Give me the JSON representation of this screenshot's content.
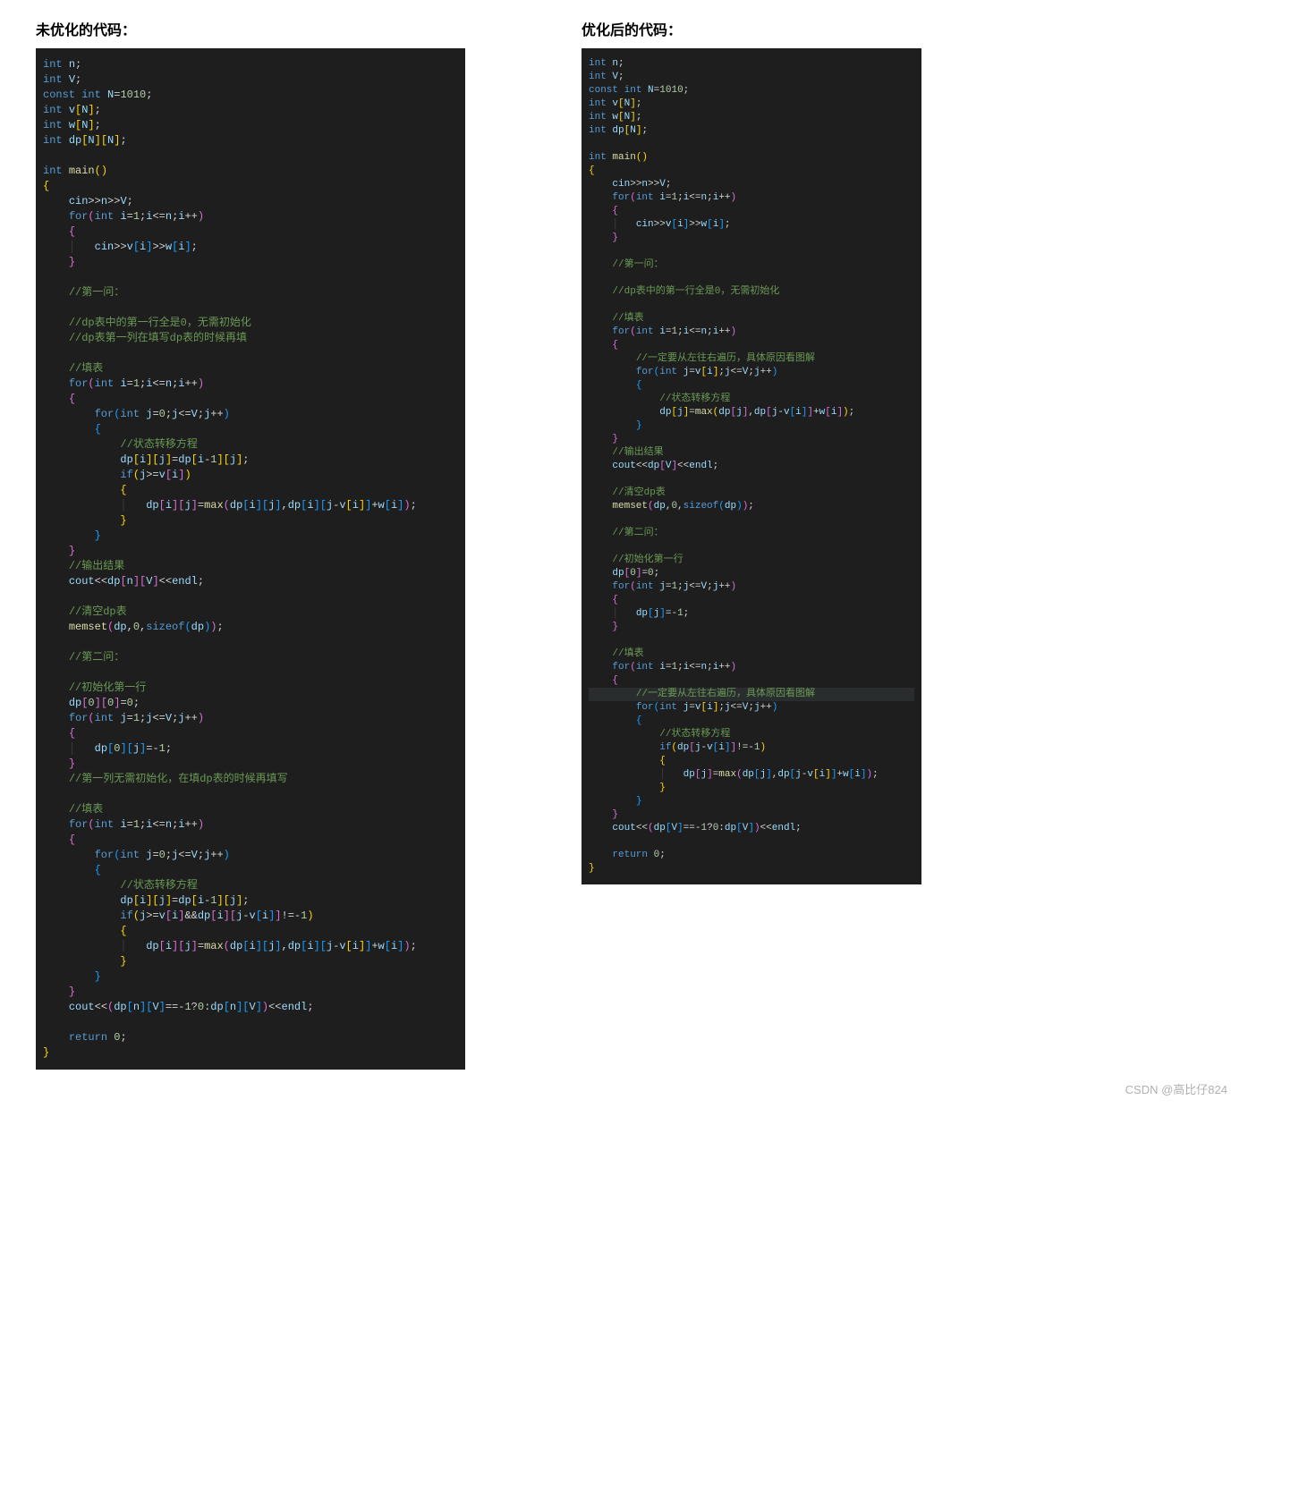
{
  "left": {
    "title": "未优化的代码：",
    "code_html": "<span class='kw'>int</span> <span class='id'>n</span>;\n<span class='kw'>int</span> <span class='id'>V</span>;\n<span class='kw'>const</span> <span class='kw'>int</span> <span class='id'>N</span>=<span class='num'>1010</span>;\n<span class='kw'>int</span> <span class='id'>v</span><span class='br'>[</span><span class='id'>N</span><span class='br'>]</span>;\n<span class='kw'>int</span> <span class='id'>w</span><span class='br'>[</span><span class='id'>N</span><span class='br'>]</span>;\n<span class='kw'>int</span> <span class='id'>dp</span><span class='br'>[</span><span class='id'>N</span><span class='br'>][</span><span class='id'>N</span><span class='br'>]</span>;\n\n<span class='kw'>int</span> <span class='fn'>main</span><span class='br'>()</span>\n<span class='br'>{</span>\n    <span class='id'>cin</span>&gt;&gt;<span class='id'>n</span>&gt;&gt;<span class='id'>V</span>;\n    <span class='kw'>for</span><span class='br2'>(</span><span class='kw'>int</span> <span class='id'>i</span>=<span class='num'>1</span>;<span class='id'>i</span>&lt;=<span class='id'>n</span>;<span class='id'>i</span>++<span class='br2'>)</span>\n    <span class='br2'>{</span>\n    <span class='guide'>│</span>   <span class='id'>cin</span>&gt;&gt;<span class='id'>v</span><span class='br3'>[</span><span class='id'>i</span><span class='br3'>]</span>&gt;&gt;<span class='id'>w</span><span class='br3'>[</span><span class='id'>i</span><span class='br3'>]</span>;\n    <span class='br2'>}</span>\n\n    <span class='cm'>//第一问：</span>\n\n    <span class='cm'>//dp表中的第一行全是0，无需初始化</span>\n    <span class='cm'>//dp表第一列在填写dp表的时候再填</span>\n\n    <span class='cm'>//填表</span>\n    <span class='kw'>for</span><span class='br2'>(</span><span class='kw'>int</span> <span class='id'>i</span>=<span class='num'>1</span>;<span class='id'>i</span>&lt;=<span class='id'>n</span>;<span class='id'>i</span>++<span class='br2'>)</span>\n    <span class='br2'>{</span>\n        <span class='kw'>for</span><span class='br3'>(</span><span class='kw'>int</span> <span class='id'>j</span>=<span class='num'>0</span>;<span class='id'>j</span>&lt;=<span class='id'>V</span>;<span class='id'>j</span>++<span class='br3'>)</span>\n        <span class='br3'>{</span>\n            <span class='cm'>//状态转移方程</span>\n            <span class='id'>dp</span><span class='br'>[</span><span class='id'>i</span><span class='br'>][</span><span class='id'>j</span><span class='br'>]</span>=<span class='id'>dp</span><span class='br'>[</span><span class='id'>i</span>-<span class='num'>1</span><span class='br'>][</span><span class='id'>j</span><span class='br'>]</span>;\n            <span class='kw'>if</span><span class='br'>(</span><span class='id'>j</span>&gt;=<span class='id'>v</span><span class='br2'>[</span><span class='id'>i</span><span class='br2'>]</span><span class='br'>)</span>\n            <span class='br'>{</span>\n            <span class='guide'>│</span>   <span class='id'>dp</span><span class='br2'>[</span><span class='id'>i</span><span class='br2'>][</span><span class='id'>j</span><span class='br2'>]</span>=<span class='fn'>max</span><span class='br2'>(</span><span class='id'>dp</span><span class='br3'>[</span><span class='id'>i</span><span class='br3'>][</span><span class='id'>j</span><span class='br3'>]</span>,<span class='id'>dp</span><span class='br3'>[</span><span class='id'>i</span><span class='br3'>][</span><span class='id'>j</span>-<span class='id'>v</span><span class='br'>[</span><span class='id'>i</span><span class='br'>]</span><span class='br3'>]</span>+<span class='id'>w</span><span class='br3'>[</span><span class='id'>i</span><span class='br3'>]</span><span class='br2'>)</span>;\n            <span class='br'>}</span>\n        <span class='br3'>}</span>\n    <span class='br2'>}</span>\n    <span class='cm'>//输出结果</span>\n    <span class='id'>cout</span>&lt;&lt;<span class='id'>dp</span><span class='br2'>[</span><span class='id'>n</span><span class='br2'>][</span><span class='id'>V</span><span class='br2'>]</span>&lt;&lt;<span class='id'>endl</span>;\n\n    <span class='cm'>//清空dp表</span>\n    <span class='fn'>memset</span><span class='br2'>(</span><span class='id'>dp</span>,<span class='num'>0</span>,<span class='kw'>sizeof</span><span class='br3'>(</span><span class='id'>dp</span><span class='br3'>)</span><span class='br2'>)</span>;\n\n    <span class='cm'>//第二问：</span>\n\n    <span class='cm'>//初始化第一行</span>\n    <span class='id'>dp</span><span class='br2'>[</span><span class='num'>0</span><span class='br2'>][</span><span class='num'>0</span><span class='br2'>]</span>=<span class='num'>0</span>;\n    <span class='kw'>for</span><span class='br2'>(</span><span class='kw'>int</span> <span class='id'>j</span>=<span class='num'>1</span>;<span class='id'>j</span>&lt;=<span class='id'>V</span>;<span class='id'>j</span>++<span class='br2'>)</span>\n    <span class='br2'>{</span>\n    <span class='guide'>│</span>   <span class='id'>dp</span><span class='br3'>[</span><span class='num'>0</span><span class='br3'>][</span><span class='id'>j</span><span class='br3'>]</span>=-<span class='num'>1</span>;\n    <span class='br2'>}</span>\n    <span class='cm'>//第一列无需初始化，在填dp表的时候再填写</span>\n\n    <span class='cm'>//填表</span>\n    <span class='kw'>for</span><span class='br2'>(</span><span class='kw'>int</span> <span class='id'>i</span>=<span class='num'>1</span>;<span class='id'>i</span>&lt;=<span class='id'>n</span>;<span class='id'>i</span>++<span class='br2'>)</span>\n    <span class='br2'>{</span>\n        <span class='kw'>for</span><span class='br3'>(</span><span class='kw'>int</span> <span class='id'>j</span>=<span class='num'>0</span>;<span class='id'>j</span>&lt;=<span class='id'>V</span>;<span class='id'>j</span>++<span class='br3'>)</span>\n        <span class='br3'>{</span>\n            <span class='cm'>//状态转移方程</span>\n            <span class='id'>dp</span><span class='br'>[</span><span class='id'>i</span><span class='br'>][</span><span class='id'>j</span><span class='br'>]</span>=<span class='id'>dp</span><span class='br'>[</span><span class='id'>i</span>-<span class='num'>1</span><span class='br'>][</span><span class='id'>j</span><span class='br'>]</span>;\n            <span class='kw'>if</span><span class='br'>(</span><span class='id'>j</span>&gt;=<span class='id'>v</span><span class='br2'>[</span><span class='id'>i</span><span class='br2'>]</span>&amp;&amp;<span class='id'>dp</span><span class='br2'>[</span><span class='id'>i</span><span class='br2'>][</span><span class='id'>j</span>-<span class='id'>v</span><span class='br3'>[</span><span class='id'>i</span><span class='br3'>]</span><span class='br2'>]</span>!=-<span class='num'>1</span><span class='br'>)</span>\n            <span class='br'>{</span>\n            <span class='guide'>│</span>   <span class='id'>dp</span><span class='br2'>[</span><span class='id'>i</span><span class='br2'>][</span><span class='id'>j</span><span class='br2'>]</span>=<span class='fn'>max</span><span class='br2'>(</span><span class='id'>dp</span><span class='br3'>[</span><span class='id'>i</span><span class='br3'>][</span><span class='id'>j</span><span class='br3'>]</span>,<span class='id'>dp</span><span class='br3'>[</span><span class='id'>i</span><span class='br3'>][</span><span class='id'>j</span>-<span class='id'>v</span><span class='br'>[</span><span class='id'>i</span><span class='br'>]</span><span class='br3'>]</span>+<span class='id'>w</span><span class='br3'>[</span><span class='id'>i</span><span class='br3'>]</span><span class='br2'>)</span>;\n            <span class='br'>}</span>\n        <span class='br3'>}</span>\n    <span class='br2'>}</span>\n    <span class='id'>cout</span>&lt;&lt;<span class='br2'>(</span><span class='id'>dp</span><span class='br3'>[</span><span class='id'>n</span><span class='br3'>][</span><span class='id'>V</span><span class='br3'>]</span>==-<span class='num'>1</span>?<span class='num'>0</span>:<span class='id'>dp</span><span class='br3'>[</span><span class='id'>n</span><span class='br3'>][</span><span class='id'>V</span><span class='br3'>]</span><span class='br2'>)</span>&lt;&lt;<span class='id'>endl</span>;\n\n    <span class='kw'>return</span> <span class='num'>0</span>;\n<span class='br'>}</span>"
  },
  "right": {
    "title": "优化后的代码：",
    "code_html": "<span class='kw'>int</span> <span class='id'>n</span>;\n<span class='kw'>int</span> <span class='id'>V</span>;\n<span class='kw'>const</span> <span class='kw'>int</span> <span class='id'>N</span>=<span class='num'>1010</span>;\n<span class='kw'>int</span> <span class='id'>v</span><span class='br'>[</span><span class='id'>N</span><span class='br'>]</span>;\n<span class='kw'>int</span> <span class='id'>w</span><span class='br'>[</span><span class='id'>N</span><span class='br'>]</span>;\n<span class='kw'>int</span> <span class='id'>dp</span><span class='br'>[</span><span class='id'>N</span><span class='br'>]</span>;\n\n<span class='kw'>int</span> <span class='fn'>main</span><span class='br'>()</span>\n<span class='br'>{</span>\n    <span class='id'>cin</span>&gt;&gt;<span class='id'>n</span>&gt;&gt;<span class='id'>V</span>;\n    <span class='kw'>for</span><span class='br2'>(</span><span class='kw'>int</span> <span class='id'>i</span>=<span class='num'>1</span>;<span class='id'>i</span>&lt;=<span class='id'>n</span>;<span class='id'>i</span>++<span class='br2'>)</span>\n    <span class='br2'>{</span>\n    <span class='guide'>│</span>   <span class='id'>cin</span>&gt;&gt;<span class='id'>v</span><span class='br3'>[</span><span class='id'>i</span><span class='br3'>]</span>&gt;&gt;<span class='id'>w</span><span class='br3'>[</span><span class='id'>i</span><span class='br3'>]</span>;\n    <span class='br2'>}</span>\n\n    <span class='cm'>//第一问：</span>\n\n    <span class='cm'>//dp表中的第一行全是0，无需初始化</span>\n\n    <span class='cm'>//填表</span>\n    <span class='kw'>for</span><span class='br2'>(</span><span class='kw'>int</span> <span class='id'>i</span>=<span class='num'>1</span>;<span class='id'>i</span>&lt;=<span class='id'>n</span>;<span class='id'>i</span>++<span class='br2'>)</span>\n    <span class='br2'>{</span>\n        <span class='cm'>//一定要从左往右遍历，具体原因看图解</span>\n        <span class='kw'>for</span><span class='br3'>(</span><span class='kw'>int</span> <span class='id'>j</span>=<span class='id'>v</span><span class='br'>[</span><span class='id'>i</span><span class='br'>]</span>;<span class='id'>j</span>&lt;=<span class='id'>V</span>;<span class='id'>j</span>++<span class='br3'>)</span>\n        <span class='br3'>{</span>\n            <span class='cm'>//状态转移方程</span>\n            <span class='id'>dp</span><span class='br'>[</span><span class='id'>j</span><span class='br'>]</span>=<span class='fn'>max</span><span class='br'>(</span><span class='id'>dp</span><span class='br2'>[</span><span class='id'>j</span><span class='br2'>]</span>,<span class='id'>dp</span><span class='br2'>[</span><span class='id'>j</span>-<span class='id'>v</span><span class='br3'>[</span><span class='id'>i</span><span class='br3'>]</span><span class='br2'>]</span>+<span class='id'>w</span><span class='br2'>[</span><span class='id'>i</span><span class='br2'>]</span><span class='br'>)</span>;\n        <span class='br3'>}</span>\n    <span class='br2'>}</span>\n    <span class='cm'>//输出结果</span>\n    <span class='id'>cout</span>&lt;&lt;<span class='id'>dp</span><span class='br2'>[</span><span class='id'>V</span><span class='br2'>]</span>&lt;&lt;<span class='id'>endl</span>;\n\n    <span class='cm'>//清空dp表</span>\n    <span class='fn'>memset</span><span class='br2'>(</span><span class='id'>dp</span>,<span class='num'>0</span>,<span class='kw'>sizeof</span><span class='br3'>(</span><span class='id'>dp</span><span class='br3'>)</span><span class='br2'>)</span>;\n\n    <span class='cm'>//第二问：</span>\n\n    <span class='cm'>//初始化第一行</span>\n    <span class='id'>dp</span><span class='br2'>[</span><span class='num'>0</span><span class='br2'>]</span>=<span class='num'>0</span>;\n    <span class='kw'>for</span><span class='br2'>(</span><span class='kw'>int</span> <span class='id'>j</span>=<span class='num'>1</span>;<span class='id'>j</span>&lt;=<span class='id'>V</span>;<span class='id'>j</span>++<span class='br2'>)</span>\n    <span class='br2'>{</span>\n    <span class='guide'>│</span>   <span class='id'>dp</span><span class='br3'>[</span><span class='id'>j</span><span class='br3'>]</span>=-<span class='num'>1</span>;\n    <span class='br2'>}</span>\n\n    <span class='cm'>//填表</span>\n    <span class='kw'>for</span><span class='br2'>(</span><span class='kw'>int</span> <span class='id'>i</span>=<span class='num'>1</span>;<span class='id'>i</span>&lt;=<span class='id'>n</span>;<span class='id'>i</span>++<span class='br2'>)</span>\n    <span class='br2'>{</span>\n<span class='hl-line'>        <span class='cm'>//一定要从左往右遍历，具体原因看图解</span></span>\n        <span class='kw'>for</span><span class='br3'>(</span><span class='kw'>int</span> <span class='id'>j</span>=<span class='id'>v</span><span class='br'>[</span><span class='id'>i</span><span class='br'>]</span>;<span class='id'>j</span>&lt;=<span class='id'>V</span>;<span class='id'>j</span>++<span class='br3'>)</span>\n        <span class='br3'>{</span>\n            <span class='cm'>//状态转移方程</span>\n            <span class='kw'>if</span><span class='br'>(</span><span class='id'>dp</span><span class='br2'>[</span><span class='id'>j</span>-<span class='id'>v</span><span class='br3'>[</span><span class='id'>i</span><span class='br3'>]</span><span class='br2'>]</span>!=-<span class='num'>1</span><span class='br'>)</span>\n            <span class='br'>{</span>\n            <span class='guide'>│</span>   <span class='id'>dp</span><span class='br2'>[</span><span class='id'>j</span><span class='br2'>]</span>=<span class='fn'>max</span><span class='br2'>(</span><span class='id'>dp</span><span class='br3'>[</span><span class='id'>j</span><span class='br3'>]</span>,<span class='id'>dp</span><span class='br3'>[</span><span class='id'>j</span>-<span class='id'>v</span><span class='br'>[</span><span class='id'>i</span><span class='br'>]</span><span class='br3'>]</span>+<span class='id'>w</span><span class='br3'>[</span><span class='id'>i</span><span class='br3'>]</span><span class='br2'>)</span>;\n            <span class='br'>}</span>\n        <span class='br3'>}</span>\n    <span class='br2'>}</span>\n    <span class='id'>cout</span>&lt;&lt;<span class='br2'>(</span><span class='id'>dp</span><span class='br3'>[</span><span class='id'>V</span><span class='br3'>]</span>==-<span class='num'>1</span>?<span class='num'>0</span>:<span class='id'>dp</span><span class='br3'>[</span><span class='id'>V</span><span class='br3'>]</span><span class='br2'>)</span>&lt;&lt;<span class='id'>endl</span>;\n\n    <span class='kw'>return</span> <span class='num'>0</span>;\n<span class='br'>}</span>"
  },
  "watermark": "CSDN @高比仔824"
}
